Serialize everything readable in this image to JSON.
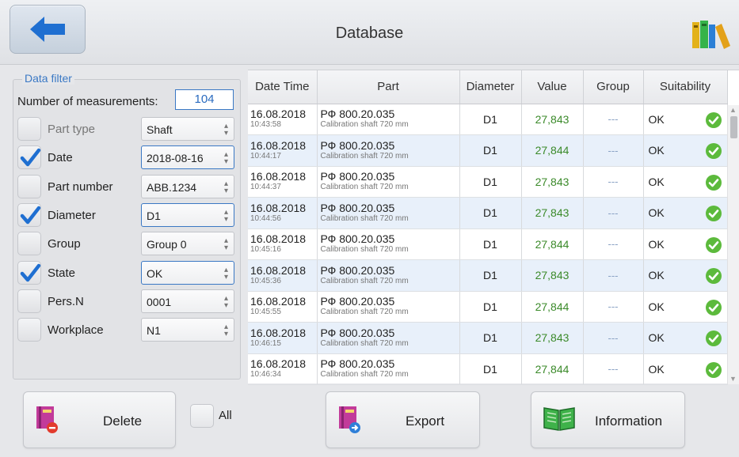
{
  "header": {
    "title": "Database"
  },
  "filter": {
    "legend": "Data filter",
    "count_label": "Number of measurements:",
    "count_value": "104",
    "rows": [
      {
        "label": "Part type",
        "checked": false,
        "enabled": false,
        "value": "Shaft"
      },
      {
        "label": "Date",
        "checked": true,
        "enabled": true,
        "value": "2018-08-16"
      },
      {
        "label": "Part number",
        "checked": false,
        "enabled": true,
        "value": "ABB.1234"
      },
      {
        "label": "Diameter",
        "checked": true,
        "enabled": true,
        "value": "D1"
      },
      {
        "label": "Group",
        "checked": false,
        "enabled": true,
        "value": "Group 0"
      },
      {
        "label": "State",
        "checked": true,
        "enabled": true,
        "value": "OK"
      },
      {
        "label": "Pers.N",
        "checked": false,
        "enabled": true,
        "value": "0001"
      },
      {
        "label": "Workplace",
        "checked": false,
        "enabled": true,
        "value": "N1"
      }
    ]
  },
  "table": {
    "columns": [
      "Date Time",
      "Part",
      "Diameter",
      "Value",
      "Group",
      "Suitability"
    ],
    "rows": [
      {
        "date": "16.08.2018",
        "time": "10:43:58",
        "part": "РФ 800.20.035",
        "part_desc": "Calibration shaft 720 mm",
        "diameter": "D1",
        "value": "27,843",
        "group": "---",
        "suitability": "OK"
      },
      {
        "date": "16.08.2018",
        "time": "10:44:17",
        "part": "РФ 800.20.035",
        "part_desc": "Calibration shaft 720 mm",
        "diameter": "D1",
        "value": "27,844",
        "group": "---",
        "suitability": "OK"
      },
      {
        "date": "16.08.2018",
        "time": "10:44:37",
        "part": "РФ 800.20.035",
        "part_desc": "Calibration shaft 720 mm",
        "diameter": "D1",
        "value": "27,843",
        "group": "---",
        "suitability": "OK"
      },
      {
        "date": "16.08.2018",
        "time": "10:44:56",
        "part": "РФ 800.20.035",
        "part_desc": "Calibration shaft 720 mm",
        "diameter": "D1",
        "value": "27,843",
        "group": "---",
        "suitability": "OK"
      },
      {
        "date": "16.08.2018",
        "time": "10:45:16",
        "part": "РФ 800.20.035",
        "part_desc": "Calibration shaft 720 mm",
        "diameter": "D1",
        "value": "27,844",
        "group": "---",
        "suitability": "OK"
      },
      {
        "date": "16.08.2018",
        "time": "10:45:36",
        "part": "РФ 800.20.035",
        "part_desc": "Calibration shaft 720 mm",
        "diameter": "D1",
        "value": "27,843",
        "group": "---",
        "suitability": "OK"
      },
      {
        "date": "16.08.2018",
        "time": "10:45:55",
        "part": "РФ 800.20.035",
        "part_desc": "Calibration shaft 720 mm",
        "diameter": "D1",
        "value": "27,844",
        "group": "---",
        "suitability": "OK"
      },
      {
        "date": "16.08.2018",
        "time": "10:46:15",
        "part": "РФ 800.20.035",
        "part_desc": "Calibration shaft 720 mm",
        "diameter": "D1",
        "value": "27,843",
        "group": "---",
        "suitability": "OK"
      },
      {
        "date": "16.08.2018",
        "time": "10:46:34",
        "part": "РФ 800.20.035",
        "part_desc": "Calibration shaft 720 mm",
        "diameter": "D1",
        "value": "27,844",
        "group": "---",
        "suitability": "OK"
      }
    ]
  },
  "footer": {
    "delete_label": "Delete",
    "all_label": "All",
    "export_label": "Export",
    "information_label": "Information"
  },
  "icons": {
    "back": "arrow-left-icon",
    "library": "books-icon",
    "ok": "check-circle-icon",
    "delete": "book-delete-icon",
    "export": "book-export-icon",
    "information": "open-book-icon"
  },
  "colors": {
    "accent": "#3a78c4",
    "value_text": "#3b8a2a",
    "ok_green": "#5cba3c",
    "row_alt": "#e8f0fa"
  }
}
